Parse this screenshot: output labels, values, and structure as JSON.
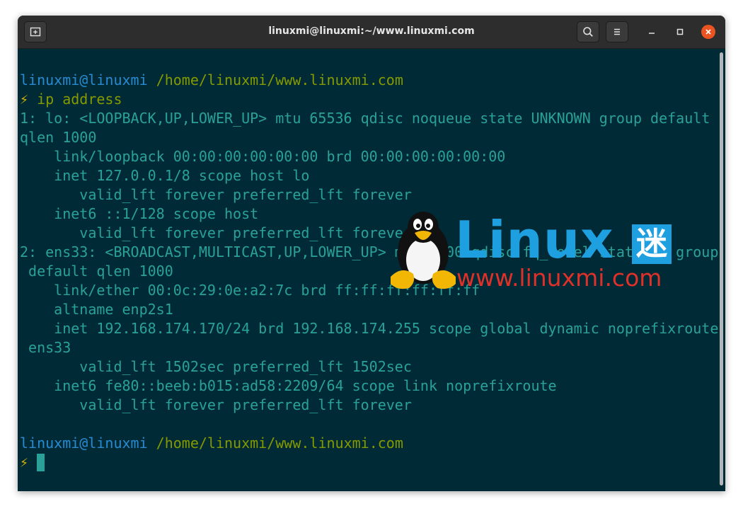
{
  "window": {
    "title": "linuxmi@linuxmi:~/www.linuxmi.com"
  },
  "titlebar": {
    "new_tab_icon": "new-tab-icon",
    "search_icon": "search-icon",
    "menu_icon": "hamburger-menu-icon",
    "minimize_icon": "minimize-icon",
    "maximize_icon": "maximize-icon",
    "close_icon": "close-icon",
    "close_color": "#e95420"
  },
  "terminal": {
    "colors": {
      "background": "#002b36",
      "text": "#2aa198",
      "user": "#268bd2",
      "path": "#859900",
      "prompt_symbol": "#d4b000"
    },
    "prompt1": {
      "user": "linuxmi@linuxmi",
      "path": "/home/linuxmi/www.linuxmi.com",
      "symbol": "⚡",
      "command": "ip address"
    },
    "output": [
      "1: lo: <LOOPBACK,UP,LOWER_UP> mtu 65536 qdisc noqueue state UNKNOWN group default",
      "qlen 1000",
      "    link/loopback 00:00:00:00:00:00 brd 00:00:00:00:00:00",
      "    inet 127.0.0.1/8 scope host lo",
      "       valid_lft forever preferred_lft forever",
      "    inet6 ::1/128 scope host",
      "       valid_lft forever preferred_lft forever",
      "2: ens33: <BROADCAST,MULTICAST,UP,LOWER_UP> mtu 1500 qdisc fq_codel state UP group",
      " default qlen 1000",
      "    link/ether 00:0c:29:0e:a2:7c brd ff:ff:ff:ff:ff:ff",
      "    altname enp2s1",
      "    inet 192.168.174.170/24 brd 192.168.174.255 scope global dynamic noprefixroute",
      " ens33",
      "       valid_lft 1502sec preferred_lft 1502sec",
      "    inet6 fe80::beeb:b015:ad58:2209/64 scope link noprefixroute",
      "       valid_lft forever preferred_lft forever"
    ],
    "prompt2": {
      "user": "linuxmi@linuxmi",
      "path": "/home/linuxmi/www.linuxmi.com",
      "symbol": "⚡"
    }
  },
  "watermark": {
    "logo_text": "Linux",
    "logo_char": "迷",
    "url": "www.linuxmi.com",
    "mascot_icon": "tux-penguin-icon",
    "brand_blue": "#1e9fe0",
    "brand_red": "#e0302a"
  }
}
